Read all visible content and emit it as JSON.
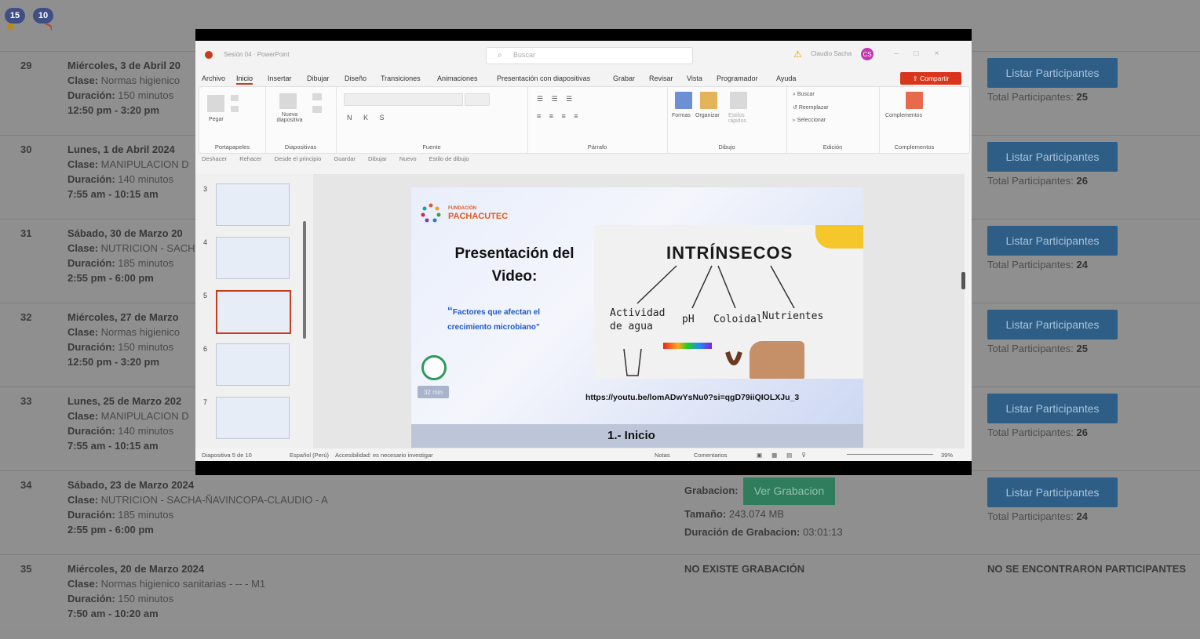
{
  "badges": [
    "15",
    "10"
  ],
  "sessions": [
    {
      "num": "29",
      "date": "Miércoles, 3 de Abril 20",
      "clase_label": "Clase:",
      "clase": "Normas higienico",
      "dur_label": "Duración:",
      "dur": "150 minutos",
      "time": "12:50 pm - 3:20 pm",
      "listar": "Listar Participantes",
      "total_label": "Total Participantes:",
      "total": "25"
    },
    {
      "num": "30",
      "date": "Lunes, 1 de Abril 2024",
      "clase_label": "Clase:",
      "clase": "MANIPULACION D",
      "dur_label": "Duración:",
      "dur": "140 minutos",
      "time": "7:55 am - 10:15 am",
      "listar": "Listar Participantes",
      "total_label": "Total Participantes:",
      "total": "26"
    },
    {
      "num": "31",
      "date": "Sábado, 30 de Marzo 20",
      "clase_label": "Clase:",
      "clase": "NUTRICION - SACH",
      "dur_label": "Duración:",
      "dur": "185 minutos",
      "time": "2:55 pm - 6:00 pm",
      "listar": "Listar Participantes",
      "total_label": "Total Participantes:",
      "total": "24"
    },
    {
      "num": "32",
      "date": "Miércoles, 27 de Marzo",
      "clase_label": "Clase:",
      "clase": "Normas higienico",
      "dur_label": "Duración:",
      "dur": "150 minutos",
      "time": "12:50 pm - 3:20 pm",
      "listar": "Listar Participantes",
      "total_label": "Total Participantes:",
      "total": "25"
    },
    {
      "num": "33",
      "date": "Lunes, 25 de Marzo 202",
      "clase_label": "Clase:",
      "clase": "MANIPULACION D",
      "dur_label": "Duración:",
      "dur": "140 minutos",
      "time": "7:55 am - 10:15 am",
      "listar": "Listar Participantes",
      "total_label": "Total Participantes:",
      "total": "26"
    },
    {
      "num": "34",
      "date": "Sábado, 23 de Marzo 2024",
      "clase_label": "Clase:",
      "clase": "NUTRICION - SACHA-ÑAVINCOPA-CLAUDIO - A",
      "dur_label": "Duración:",
      "dur": "185 minutos",
      "time": "2:55 pm - 6:00 pm",
      "listar": "Listar Participantes",
      "total_label": "Total Participantes:",
      "total": "24",
      "recording": {
        "label": "Grabacion:",
        "button": "Ver Grabacion",
        "size_label": "Tamaño:",
        "size": "243.074 MB",
        "dur_label": "Duración de Grabacion:",
        "dur": "03:01:13"
      }
    },
    {
      "num": "35",
      "date": "Miércoles, 20 de Marzo 2024",
      "clase_label": "Clase:",
      "clase": "Normas higienico sanitarias - -- - M1",
      "dur_label": "Duración:",
      "dur": "150 minutos",
      "time": "7:50 am - 10:20 am",
      "no_recording": "NO EXISTE GRABACIÓN",
      "no_participants": "NO SE ENCONTRARON PARTICIPANTES"
    }
  ],
  "ppt": {
    "doc_title": "Sesión 04 · PowerPoint",
    "search": "Buscar",
    "user": "Claudio Sacha",
    "avatar": "CS",
    "share": "Compartir",
    "menu": [
      "Archivo",
      "Inicio",
      "Insertar",
      "Dibujar",
      "Diseño",
      "Transiciones",
      "Animaciones",
      "Presentación con diapositivas",
      "Grabar",
      "Revisar",
      "Vista",
      "Programador",
      "Ayuda"
    ],
    "groups": [
      "Portapapeles",
      "Diapositivas",
      "Fuente",
      "Párrafo",
      "Dibujo",
      "Edición",
      "Complementos"
    ],
    "ribbon": {
      "pegar": "Pegar",
      "nueva": "Nueva diapositiva",
      "formas": "Formas",
      "organizar": "Organizar",
      "estilos": "Estilos rápidos",
      "buscar": "Buscar",
      "reemplazar": "Reemplazar",
      "seleccionar": "Seleccionar",
      "complementos": "Complementos"
    },
    "quick_access": [
      "Deshacer",
      "Rehacer",
      "Desde el principio",
      "Guardar",
      "Dibujar",
      "Nuevo",
      "Estilo de dibujo"
    ],
    "thumb_numbers": [
      "3",
      "4",
      "5",
      "6",
      "7"
    ],
    "slide": {
      "brand_small": "FUNDACIÓN",
      "brand": "PACHACUTEC",
      "title_line1": "Presentación del",
      "title_line2": "Video:",
      "subtitle_line1": "Factores que afectan el",
      "subtitle_line2": "crecimiento microbiano”",
      "open_quote": "“",
      "mins": "32 min",
      "wb_title": "INTRÍNSECOS",
      "wb_labels": [
        "Actividad",
        "de agua",
        "pH",
        "Coloidal",
        "Nutrientes"
      ],
      "url": "https://youtu.be/lomADwYsNu0?si=qgD79iiQIOLXJu_3",
      "footer": "1.- Inicio"
    },
    "status": {
      "slide": "Diapositiva 5 de 10",
      "lang": "Español (Perú)",
      "access": "Accesibilidad: es necesario investigar",
      "notes": "Notas",
      "comments": "Comentarios",
      "zoom": "39%"
    }
  }
}
